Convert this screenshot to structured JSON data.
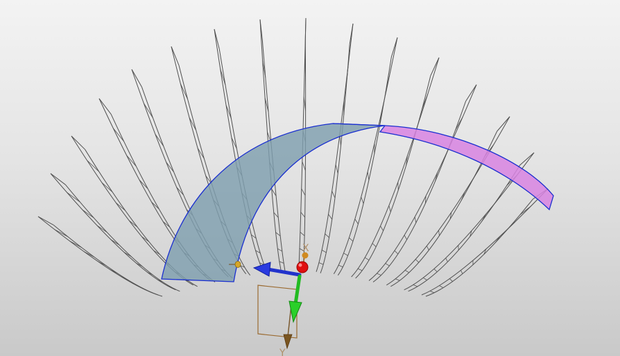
{
  "viewport": {
    "background_top": "#f3f3f3",
    "background_bottom": "#c9c9c9"
  },
  "model": {
    "wire_color": "#505050",
    "blade_count": 14,
    "sweep_surface": {
      "fill": "#7f9fae",
      "edge": "#1a2fd0",
      "highlight_fill": "#d884e2"
    }
  },
  "manipulator": {
    "x_axis_label": "X",
    "y_axis_label": "Y",
    "origin_color": "#e01010",
    "arrow_blue": "#2233cc",
    "arrow_green": "#22bb22",
    "frame_color": "#9a6a30"
  }
}
